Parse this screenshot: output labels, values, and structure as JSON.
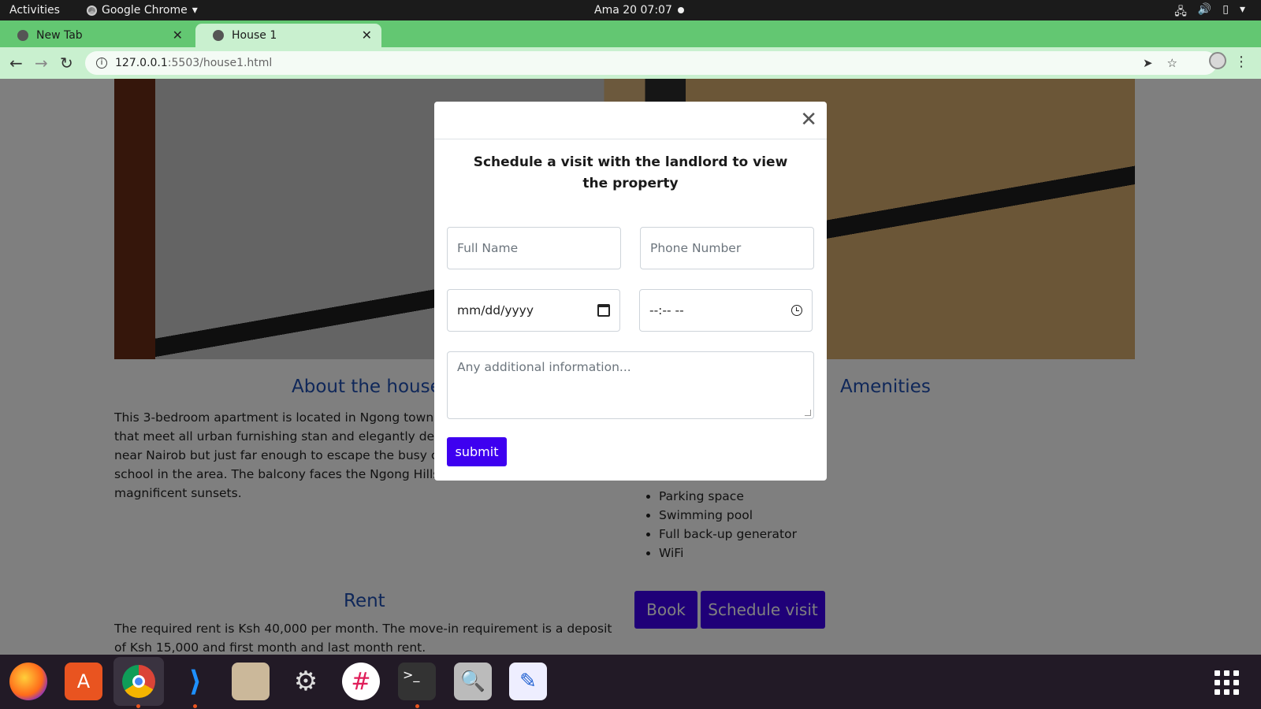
{
  "topbar": {
    "activities": "Activities",
    "app_name": "Google Chrome",
    "clock": "Ama 20  07:07"
  },
  "browser": {
    "tabs": [
      {
        "label": "New Tab",
        "icon": "chrome-icon"
      },
      {
        "label": "House 1",
        "icon": "globe-icon"
      }
    ],
    "url_host": "127.0.0.1",
    "url_path": ":5503/house1.html"
  },
  "page": {
    "about_heading": "About the house",
    "about_text": "This 3-bedroom apartment is located in Ngong town. The furnished bathrooms that meet all urban furnishing stan and elegantly designed.The house is located near Nairob but just far enough to escape the busy city. It is also clos as the best school in the area. The balcony faces the Ngong Hills, treating you to a view of magnificent sunsets.",
    "amenities_heading": "Amenities",
    "amenities": [
      "Parking space",
      "Swimming pool",
      "Full back-up generator",
      "WiFi"
    ],
    "rent_heading": "Rent",
    "rent_text": "The required rent is Ksh 40,000 per month. The move-in requirement is a deposit of Ksh 15,000 and first month and last month rent.",
    "book_label": "Book",
    "schedule_label": "Schedule visit"
  },
  "modal": {
    "title": "Schedule a visit with the landlord to view the property",
    "full_name_placeholder": "Full Name",
    "phone_placeholder": "Phone Number",
    "date_placeholder": "mm/dd/yyyy",
    "time_placeholder": "--:-- --",
    "info_placeholder": "Any additional information...",
    "submit_label": "submit"
  },
  "colors": {
    "accent": "#3e00f0",
    "heading": "#1f4fb3",
    "tabstrip": "#63c772"
  }
}
